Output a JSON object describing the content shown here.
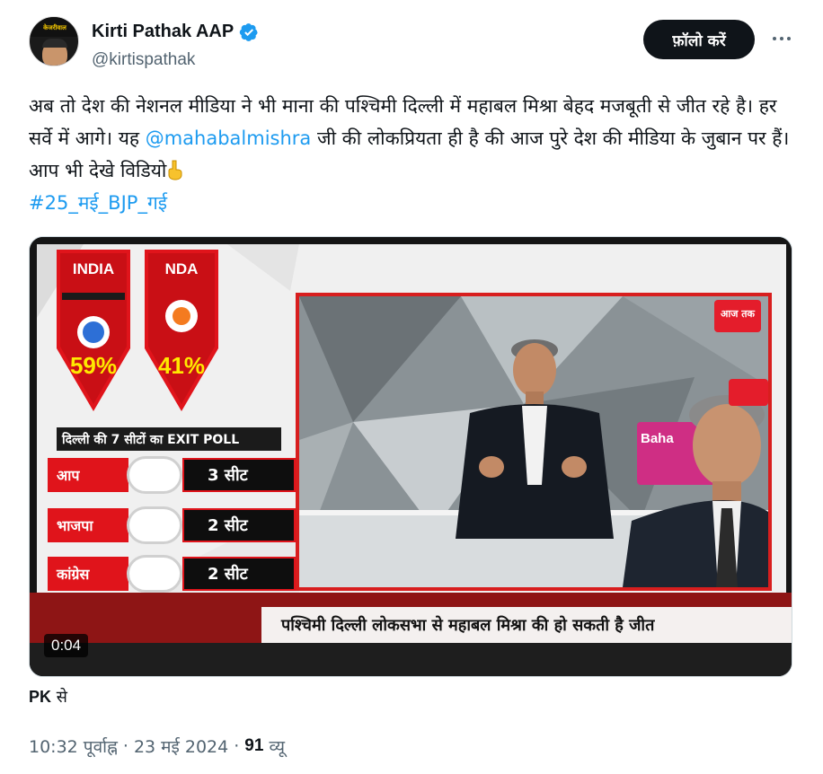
{
  "author": {
    "display_name": "Kirti Pathak AAP",
    "handle": "@kirtispathak",
    "verified_icon": "verified-badge-icon",
    "avatar_text": "केजरीवाल"
  },
  "actions": {
    "follow_label": "फ़ॉलो करें",
    "more_icon": "more-options-icon"
  },
  "tweet": {
    "text_part1": "अब तो देश की नेशनल मीडिया ने भी माना की पश्चिमी दिल्ली में महाबल मिश्रा बेहद मजबूती से जीत रहे है। हर सर्वे में आगे। यह ",
    "mention": "@mahabalmishra",
    "text_part2": " जी की लोकप्रियता ही है की आज पुरे देश की मीडिया के जुबान पर हैं। आप भी देखे विडियो",
    "emoji_icon": "pointing-down-icon",
    "hashtag": "#25_मई_BJP_गई"
  },
  "media": {
    "duration": "0:04",
    "alliances": [
      {
        "label": "INDIA",
        "percent": "59%"
      },
      {
        "label": "NDA",
        "percent": "41%"
      }
    ],
    "exit_poll_title": "दिल्ली की 7 सीटों का EXIT POLL",
    "parties": [
      {
        "name": "आप",
        "seats": "3 सीट",
        "logo": "aap"
      },
      {
        "name": "भाजपा",
        "seats": "2 सीट",
        "logo": "bjp"
      },
      {
        "name": "कांग्रेस",
        "seats": "2 सीट",
        "logo": "congress"
      }
    ],
    "ticker": "पश्चिमी दिल्ली लोकसभा से महाबल मिश्रा की हो सकती है जीत",
    "channel_logo": "aaj-tak-logo-icon",
    "channel_text": "आज तक",
    "studio_sign": "Baha"
  },
  "source_line": {
    "name": "PK",
    "suffix": " से"
  },
  "meta": {
    "time": "10:32 पूर्वाह्न",
    "separator": "·",
    "date": "23 मई 2024",
    "views_count": "91",
    "views_label": "व्यू"
  },
  "colors": {
    "link": "#1d9bf0",
    "verified": "#1d9bf0",
    "follow_bg": "#0f1419",
    "accent_red": "#e0141b"
  }
}
